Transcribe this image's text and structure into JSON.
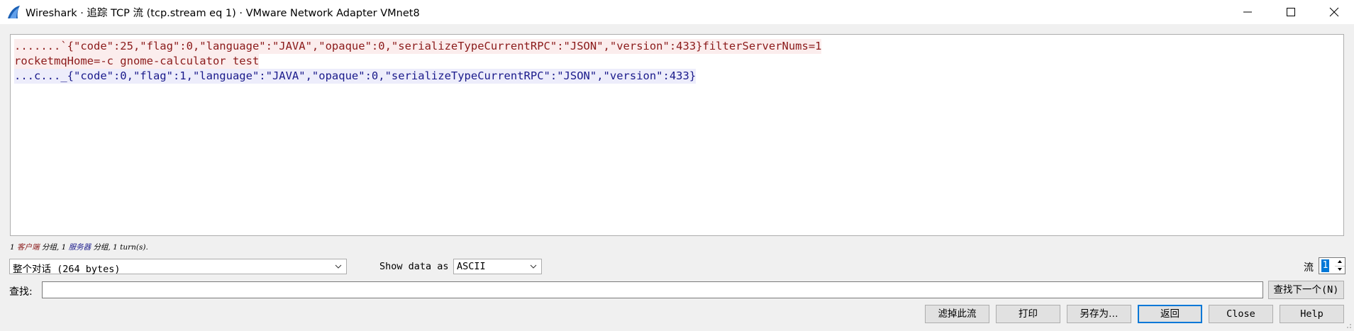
{
  "window": {
    "title": "Wireshark · 追踪 TCP 流 (tcp.stream eq 1) · VMware Network Adapter VMnet8"
  },
  "stream": {
    "lines": [
      {
        "dir": "client",
        "text": ".......`{\"code\":25,\"flag\":0,\"language\":\"JAVA\",\"opaque\":0,\"serializeTypeCurrentRPC\":\"JSON\",\"version\":433}filterServerNums=1"
      },
      {
        "dir": "client",
        "text": "rocketmqHome=-c gnome-calculator test"
      },
      {
        "dir": "server",
        "text": "...c..._{\"code\":0,\"flag\":1,\"language\":\"JAVA\",\"opaque\":0,\"serializeTypeCurrentRPC\":\"JSON\",\"version\":433}"
      }
    ]
  },
  "info": {
    "client_count": "1",
    "client_label": "客户端",
    "client_suffix": "分组,",
    "server_count": "1",
    "server_label": "服务器",
    "server_suffix": "分组,",
    "turns": "1 turn(s)."
  },
  "controls": {
    "conversation": "整个对话 (264 bytes)",
    "show_data_label": "Show data as",
    "show_data_value": "ASCII",
    "stream_label": "流",
    "stream_value": "1",
    "find_label": "查找:",
    "find_value": "",
    "find_next": "查找下一个(N)"
  },
  "buttons": {
    "filter_out": "滤掉此流",
    "print": "打印",
    "save_as": "另存为…",
    "back": "返回",
    "close": "Close",
    "help": "Help"
  },
  "colors": {
    "client_text": "#8b1a1a",
    "client_bg": "#fbeded",
    "server_text": "#1a1a8b",
    "server_bg": "#ededfb",
    "accent": "#0078d7"
  },
  "icons": {
    "app": "wireshark-fin-icon",
    "minimize": "minimize-icon",
    "maximize": "maximize-icon",
    "close": "close-icon"
  }
}
